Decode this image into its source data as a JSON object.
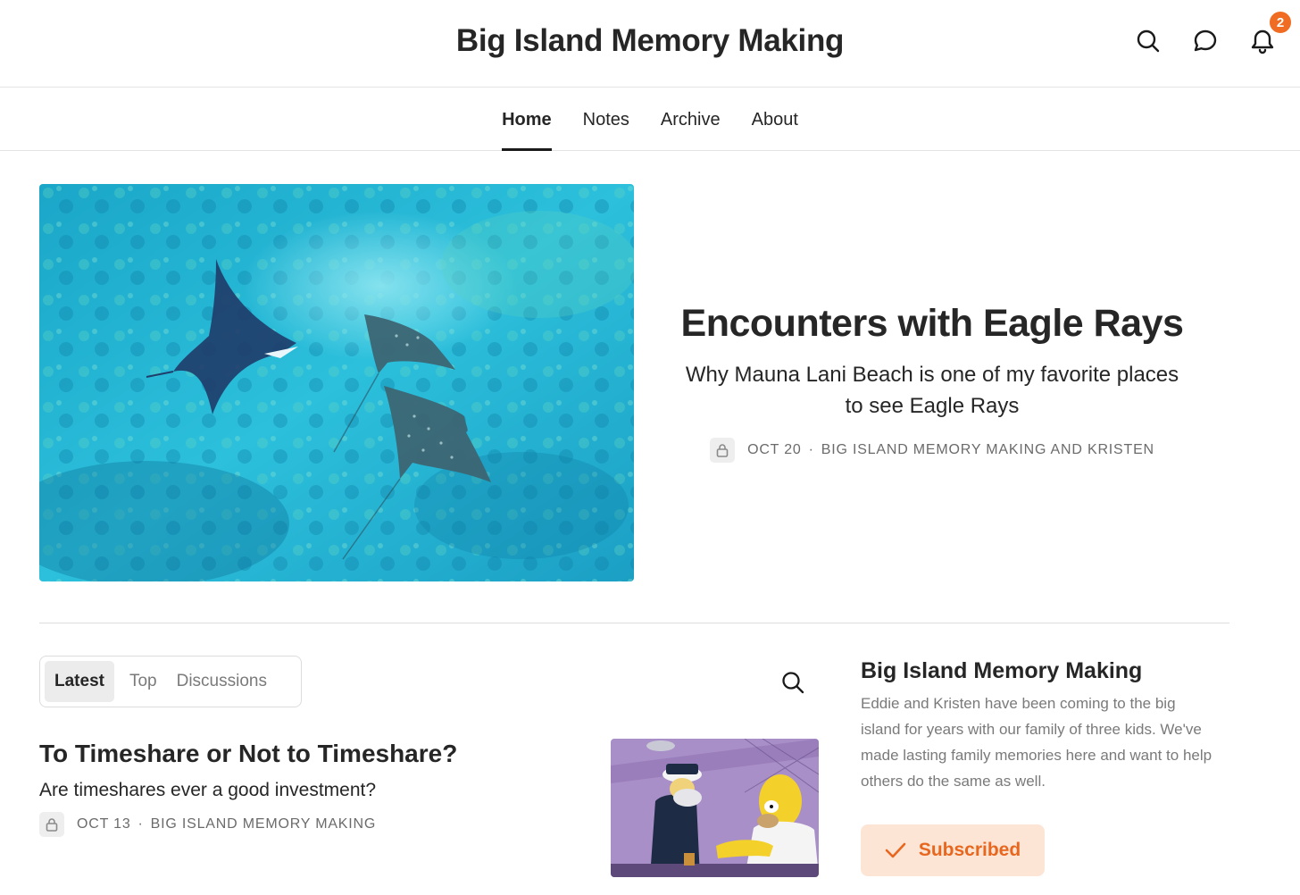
{
  "header": {
    "site_title": "Big Island Memory Making",
    "notification_count": "2",
    "icons": [
      "search-icon",
      "chat-icon",
      "bell-icon"
    ]
  },
  "nav": {
    "items": [
      {
        "label": "Home",
        "active": true
      },
      {
        "label": "Notes"
      },
      {
        "label": "Archive"
      },
      {
        "label": "About"
      }
    ]
  },
  "featured": {
    "title": "Encounters with Eagle Rays",
    "subtitle": "Why Mauna Lani Beach is one of my favorite places to see Eagle Rays",
    "date": "OCT 20",
    "separator": "·",
    "authors": "BIG ISLAND MEMORY MAKING AND KRISTEN"
  },
  "feed": {
    "tabs": [
      {
        "label": "Latest",
        "active": true
      },
      {
        "label": "Top"
      },
      {
        "label": "Discussions"
      }
    ],
    "posts": [
      {
        "title": "To Timeshare or Not to Timeshare?",
        "subtitle": "Are timeshares ever a good investment?",
        "date": "OCT 13",
        "separator": "·",
        "author": "BIG ISLAND MEMORY MAKING"
      }
    ]
  },
  "sidebar": {
    "title": "Big Island Memory Making",
    "description": "Eddie and Kristen have been coming to the big island for years with our family of three kids. We've made lasting family memories here and want to help others do the same as well.",
    "subscribe_label": "Subscribed"
  },
  "colors": {
    "accent": "#ef6c22",
    "subscribed_bg": "#fde5d6",
    "text": "#262626",
    "muted": "#7a7a7a"
  }
}
